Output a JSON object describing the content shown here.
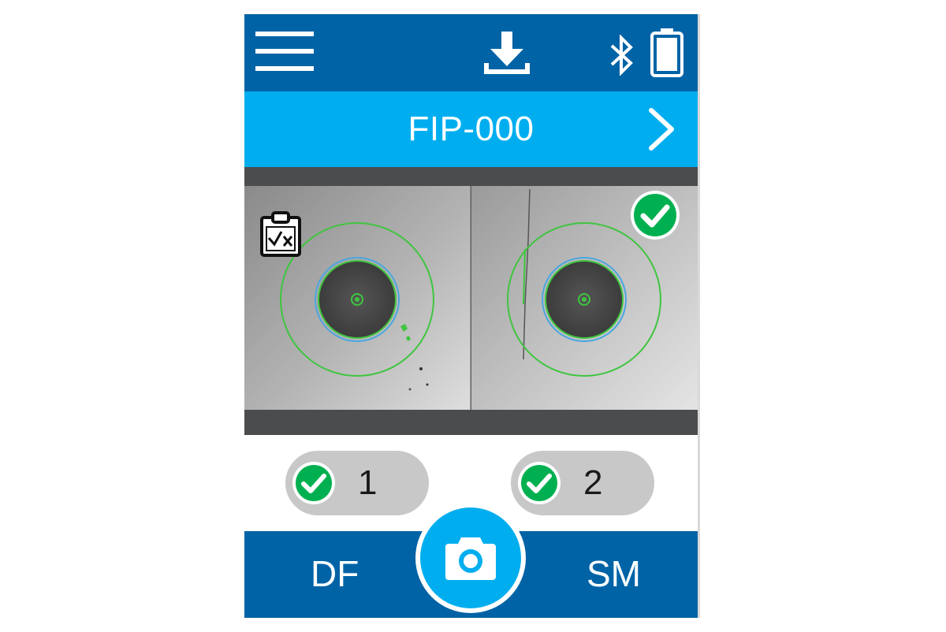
{
  "header": {
    "icons": [
      "menu-icon",
      "download-icon",
      "bluetooth-icon",
      "battery-icon"
    ]
  },
  "titlebar": {
    "title": "FIP-000",
    "next_icon": "chevron-right-icon"
  },
  "inspection": {
    "report_icon": "clipboard-fail-icon",
    "overall_status_icon": "pass-check-icon"
  },
  "results": [
    {
      "label": "1",
      "status": "pass"
    },
    {
      "label": "2",
      "status": "pass"
    }
  ],
  "footer": {
    "left_mode": "DF",
    "right_mode": "SM",
    "capture_icon": "camera-icon"
  },
  "colors": {
    "primary_dark": "#0063a6",
    "primary_light": "#00aeef",
    "pass_green": "#00b050",
    "overlay_green": "#3fc53f",
    "overlay_blue": "#4aa6e0",
    "pill_gray": "#c8c8c8"
  }
}
